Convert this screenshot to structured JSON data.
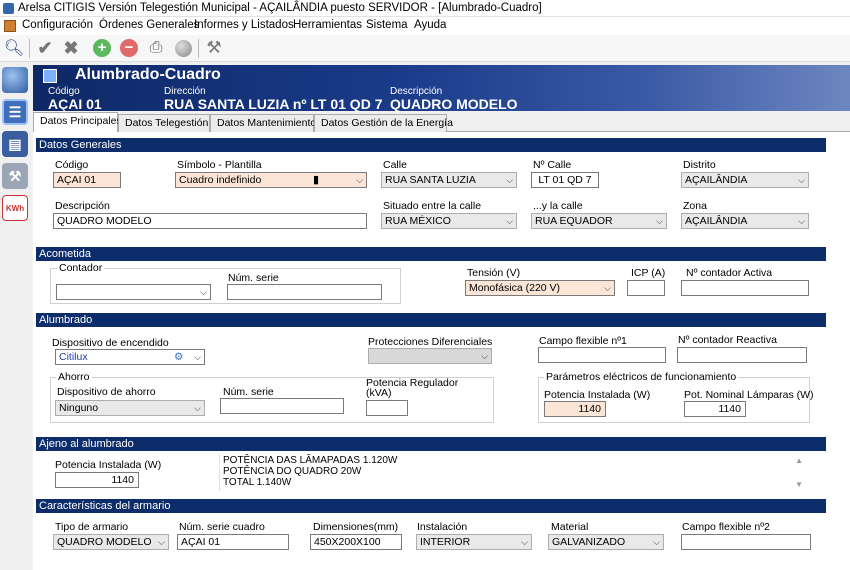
{
  "window": {
    "title": "Arelsa CITIGIS Versión Telegestión Municipal - AÇAILÂNDIA puesto SERVIDOR - [Alumbrado-Cuadro]"
  },
  "menu": {
    "items": [
      "Configuración",
      "Órdenes Generales",
      "Informes y Listados",
      "Herramientas",
      "Sistema",
      "Ayuda"
    ]
  },
  "toolbar": {
    "icons": [
      "search-icon",
      "check-icon",
      "close-icon",
      "add-icon",
      "remove-icon",
      "print-icon",
      "globe-icon",
      "tools-icon"
    ]
  },
  "sidebar": {
    "icons": [
      "globe-icon",
      "cabinet-icon",
      "book-icon",
      "tools-icon",
      "kwh-icon"
    ],
    "kwh_label": "KWh"
  },
  "header": {
    "title": "Alumbrado-Cuadro",
    "codigo_label": "Código",
    "codigo_value": "AÇAI 01",
    "direccion_label": "Dirección",
    "direccion_value": "RUA SANTA LUZIA nº LT 01 QD 7",
    "descripcion_label": "Descripción",
    "descripcion_value": "QUADRO MODELO"
  },
  "tabs": [
    "Datos Principales",
    "Datos Telegestión",
    "Datos Mantenimiento",
    "Datos Gestión de la Energía"
  ],
  "datos_generales": {
    "section": "Datos Generales",
    "codigo_label": "Código",
    "codigo": "AÇAI 01",
    "simbolo_label": "Símbolo - Plantilla",
    "simbolo": "Cuadro indefinido",
    "calle_label": "Calle",
    "calle": "RUA SANTA LUZIA",
    "ncalle_label": "Nº Calle",
    "ncalle": "LT 01 QD 7",
    "distrito_label": "Distrito",
    "distrito": "AÇAILÂNDIA",
    "descripcion_label": "Descripción",
    "descripcion": "QUADRO MODELO",
    "situado_label": "Situado entre la calle",
    "situado": "RUA MÉXICO",
    "ylacalle_label": "...y la calle",
    "ylacalle": "RUA EQUADOR",
    "zona_label": "Zona",
    "zona": "AÇAILÂNDIA"
  },
  "acometida": {
    "section": "Acometida",
    "contador_label": "Contador",
    "contador": "",
    "num_serie_label": "Núm. serie",
    "num_serie": "",
    "tension_label": "Tensión (V)",
    "tension": "Monofásica (220 V)",
    "icp_label": "ICP (A)",
    "icp": "",
    "ncontador_activa_label": "Nº contador Activa",
    "ncontador_activa": ""
  },
  "alumbrado": {
    "section": "Alumbrado",
    "dispositivo_label": "Dispositivo de encendido",
    "dispositivo": "Citilux",
    "protecciones_label": "Protecciones Diferenciales",
    "protecciones": "",
    "campo1_label": "Campo flexible nº1",
    "campo1": "",
    "ncontador_reactiva_label": "Nº contador Reactiva",
    "ncontador_reactiva": "",
    "ahorro_title": "Ahorro",
    "disp_ahorro_label": "Dispositivo de ahorro",
    "disp_ahorro": "Ninguno",
    "num_serie_label": "Núm. serie",
    "num_serie": "",
    "potencia_reg_label1": "Potencia Regulador",
    "potencia_reg_label2": "(kVA)",
    "potencia_reg": "",
    "parametros_title": "Parámetros eléctricos de funcionamiento",
    "pot_instalada_label": "Potencia Instalada (W)",
    "pot_instalada": "1140",
    "pot_nominal_label": "Pot. Nominal Lámparas (W)",
    "pot_nominal": "1140"
  },
  "ajeno": {
    "section": "Ajeno al alumbrado",
    "pot_instalada_label": "Potencia Instalada (W)",
    "pot_instalada": "1140",
    "memo": "POTÊNCIA DAS LÂMAPADAS 1.120W\nPOTÊNCIA DO QUADRO 20W\nTOTAL 1.140W"
  },
  "armario": {
    "section": "Características del armario",
    "tipo_label": "Tipo de armario",
    "tipo": "QUADRO MODELO",
    "nserie_label": "Núm. serie cuadro",
    "nserie": "AÇAI 01",
    "dimensiones_label": "Dimensiones(mm)",
    "dimensiones": "450X200X100",
    "instalacion_label": "Instalación",
    "instalacion": "INTERIOR",
    "material_label": "Material",
    "material": "GALVANIZADO",
    "campo2_label": "Campo flexible nº2",
    "campo2": ""
  },
  "colors": {
    "header": "#0e2866",
    "section": "#0c2c6a",
    "highlight": "#fbe5d6"
  }
}
